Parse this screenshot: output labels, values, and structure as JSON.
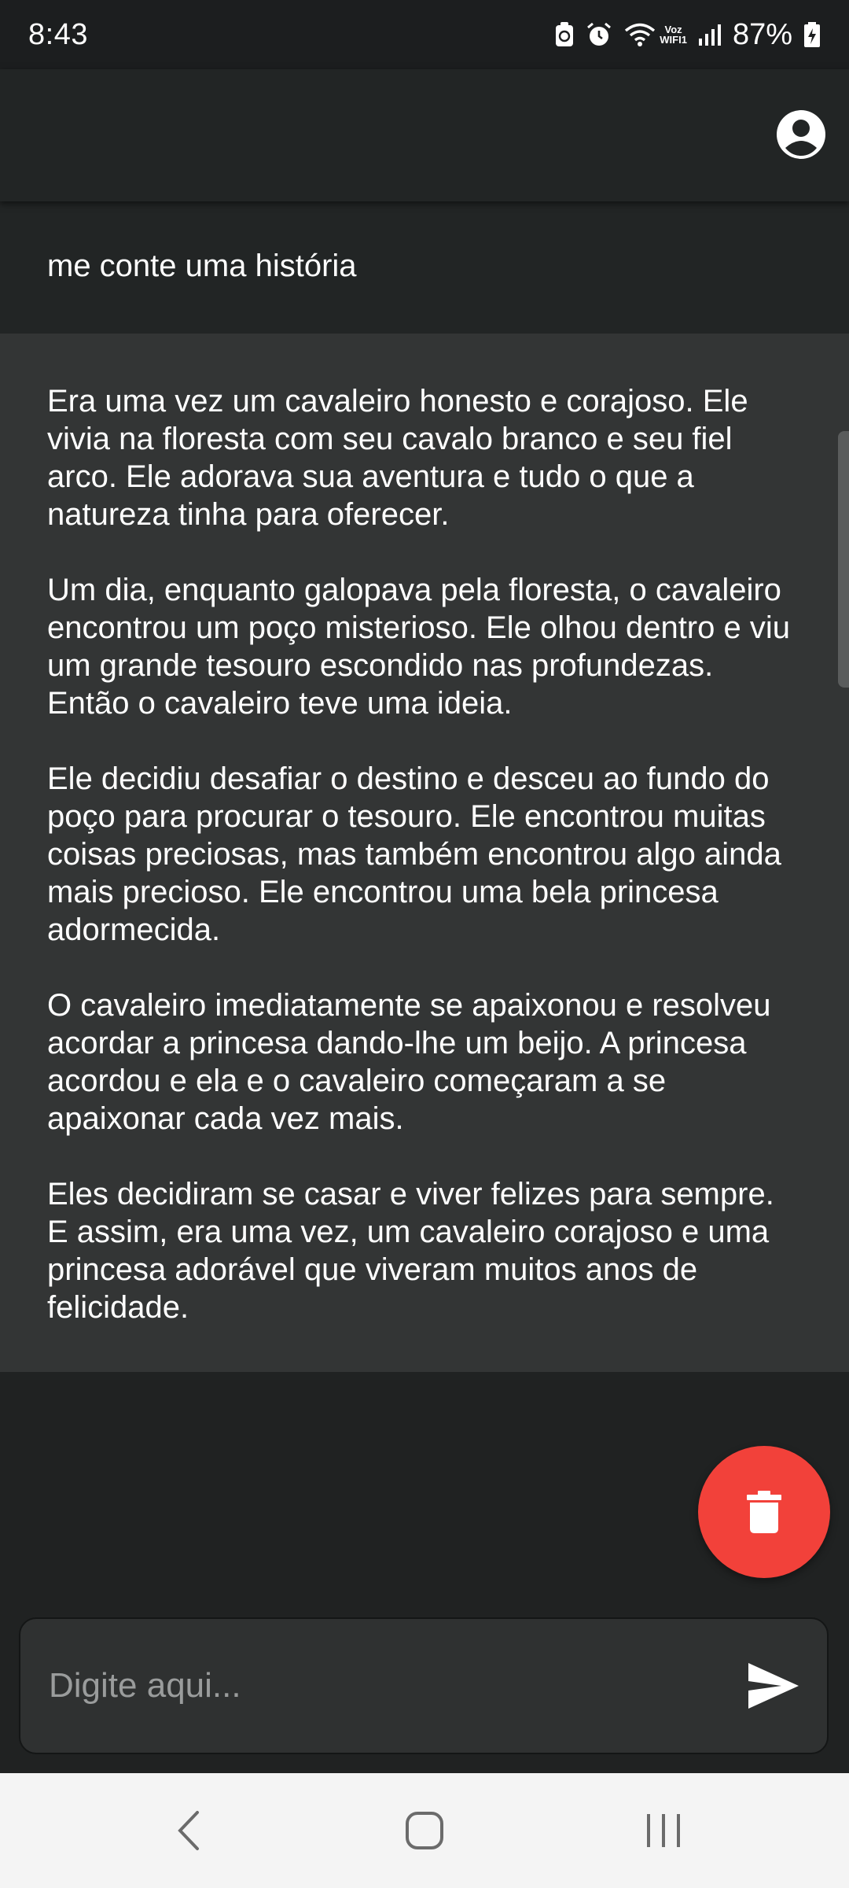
{
  "status_bar": {
    "time": "8:43",
    "voz_label_top": "Voz",
    "voz_label_bottom": "WIFI1",
    "battery": "87%",
    "icons": [
      "nfc-icon",
      "alarm-icon",
      "wifi-icon",
      "voz-wifi-icon",
      "signal-icon",
      "battery-charging-icon"
    ]
  },
  "app_bar": {
    "account_icon": "account-circle-icon"
  },
  "chat": {
    "user_message": "me conte uma história",
    "ai_paragraphs": [
      "Era uma vez um cavaleiro honesto e corajoso. Ele vivia na floresta com seu cavalo branco e seu fiel arco. Ele adorava sua aventura e tudo o que a natureza tinha para oferecer.",
      "Um dia, enquanto galopava pela floresta, o cavaleiro encontrou um poço misterioso. Ele olhou dentro e viu um grande tesouro escondido nas profundezas. Então o cavaleiro teve uma ideia.",
      "Ele decidiu desafiar o destino e desceu ao fundo do poço para procurar o tesouro. Ele encontrou muitas coisas preciosas, mas também encontrou algo ainda mais precioso. Ele encontrou uma bela princesa adormecida.",
      "O cavaleiro imediatamente se apaixonou e resolveu acordar a princesa dando-lhe um beijo. A princesa acordou e ela e o cavaleiro começaram a se apaixonar cada vez mais.",
      "Eles decidiram se casar e viver felizes para sempre. E assim, era uma vez, um cavaleiro corajoso e uma princesa adorável que viveram muitos anos de felicidade."
    ]
  },
  "delete_fab": {
    "icon": "trash-icon",
    "color": "#f2413a"
  },
  "composer": {
    "placeholder": "Digite aqui...",
    "value": "",
    "send_icon": "send-icon"
  },
  "nav_bar": {
    "icons": [
      "back-icon",
      "home-icon",
      "recents-icon"
    ]
  },
  "colors": {
    "background": "#202222",
    "ai_bubble": "#333535",
    "accent_delete": "#f2413a"
  }
}
